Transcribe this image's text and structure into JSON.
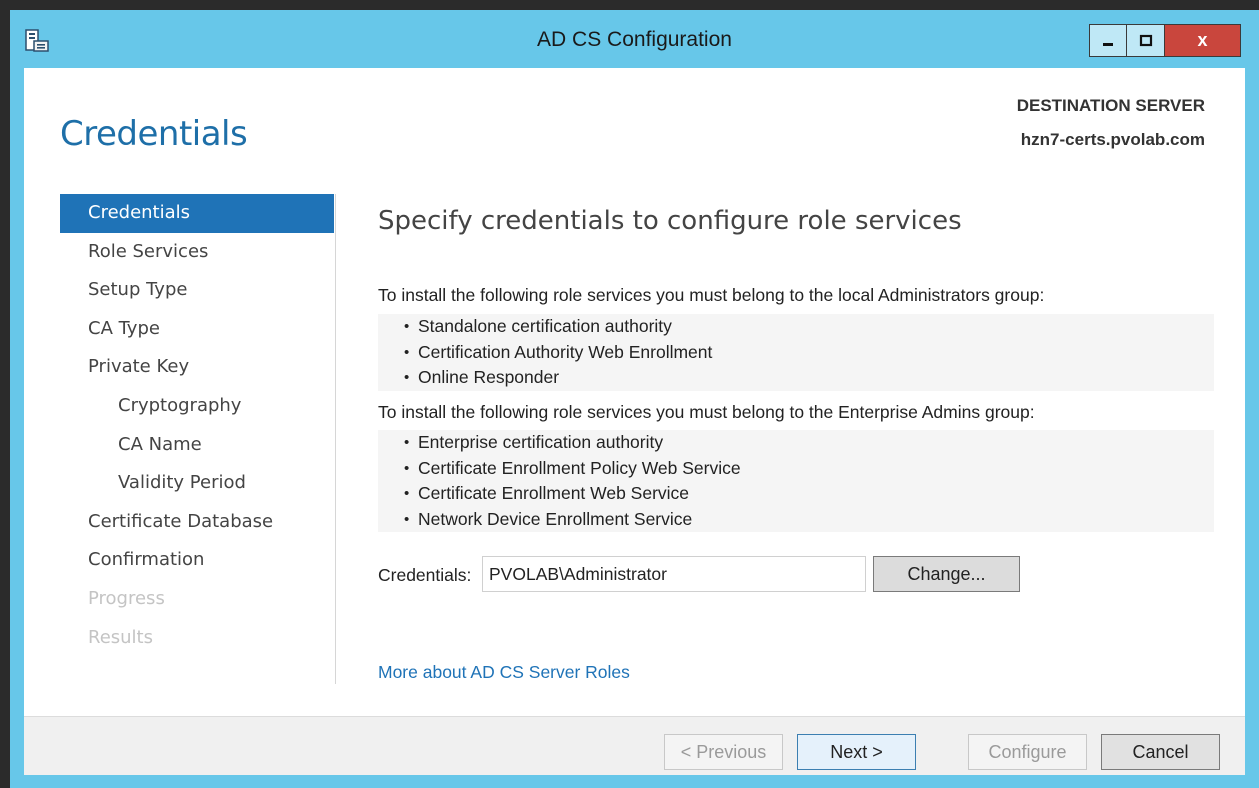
{
  "window": {
    "title": "AD CS Configuration",
    "close_glyph": "x",
    "accent_color": "#67c7e9"
  },
  "header": {
    "page_title": "Credentials",
    "destination_label": "DESTINATION SERVER",
    "destination_server": "hzn7-certs.pvolab.com"
  },
  "nav": {
    "items": [
      {
        "label": "Credentials",
        "state": "active"
      },
      {
        "label": "Role Services",
        "state": "normal"
      },
      {
        "label": "Setup Type",
        "state": "normal"
      },
      {
        "label": "CA Type",
        "state": "normal"
      },
      {
        "label": "Private Key",
        "state": "normal"
      },
      {
        "label": "Cryptography",
        "state": "sub"
      },
      {
        "label": "CA Name",
        "state": "sub"
      },
      {
        "label": "Validity Period",
        "state": "sub"
      },
      {
        "label": "Certificate Database",
        "state": "normal"
      },
      {
        "label": "Confirmation",
        "state": "normal"
      },
      {
        "label": "Progress",
        "state": "disabled"
      },
      {
        "label": "Results",
        "state": "disabled"
      }
    ]
  },
  "main": {
    "heading": "Specify credentials to configure role services",
    "local_admins_intro": "To install the following role services you must belong to the local Administrators group:",
    "local_admins_services": [
      "Standalone certification authority",
      "Certification Authority Web Enrollment",
      "Online Responder"
    ],
    "enterprise_admins_intro": "To install the following role services you must belong to the Enterprise Admins group:",
    "enterprise_admins_services": [
      "Enterprise certification authority",
      "Certificate Enrollment Policy Web Service",
      "Certificate Enrollment Web Service",
      "Network Device Enrollment Service"
    ],
    "credentials_label": "Credentials:",
    "credentials_value": "PVOLAB\\Administrator",
    "change_button": "Change...",
    "more_link": "More about AD CS Server Roles"
  },
  "footer": {
    "previous": "< Previous",
    "next": "Next >",
    "configure": "Configure",
    "cancel": "Cancel"
  }
}
